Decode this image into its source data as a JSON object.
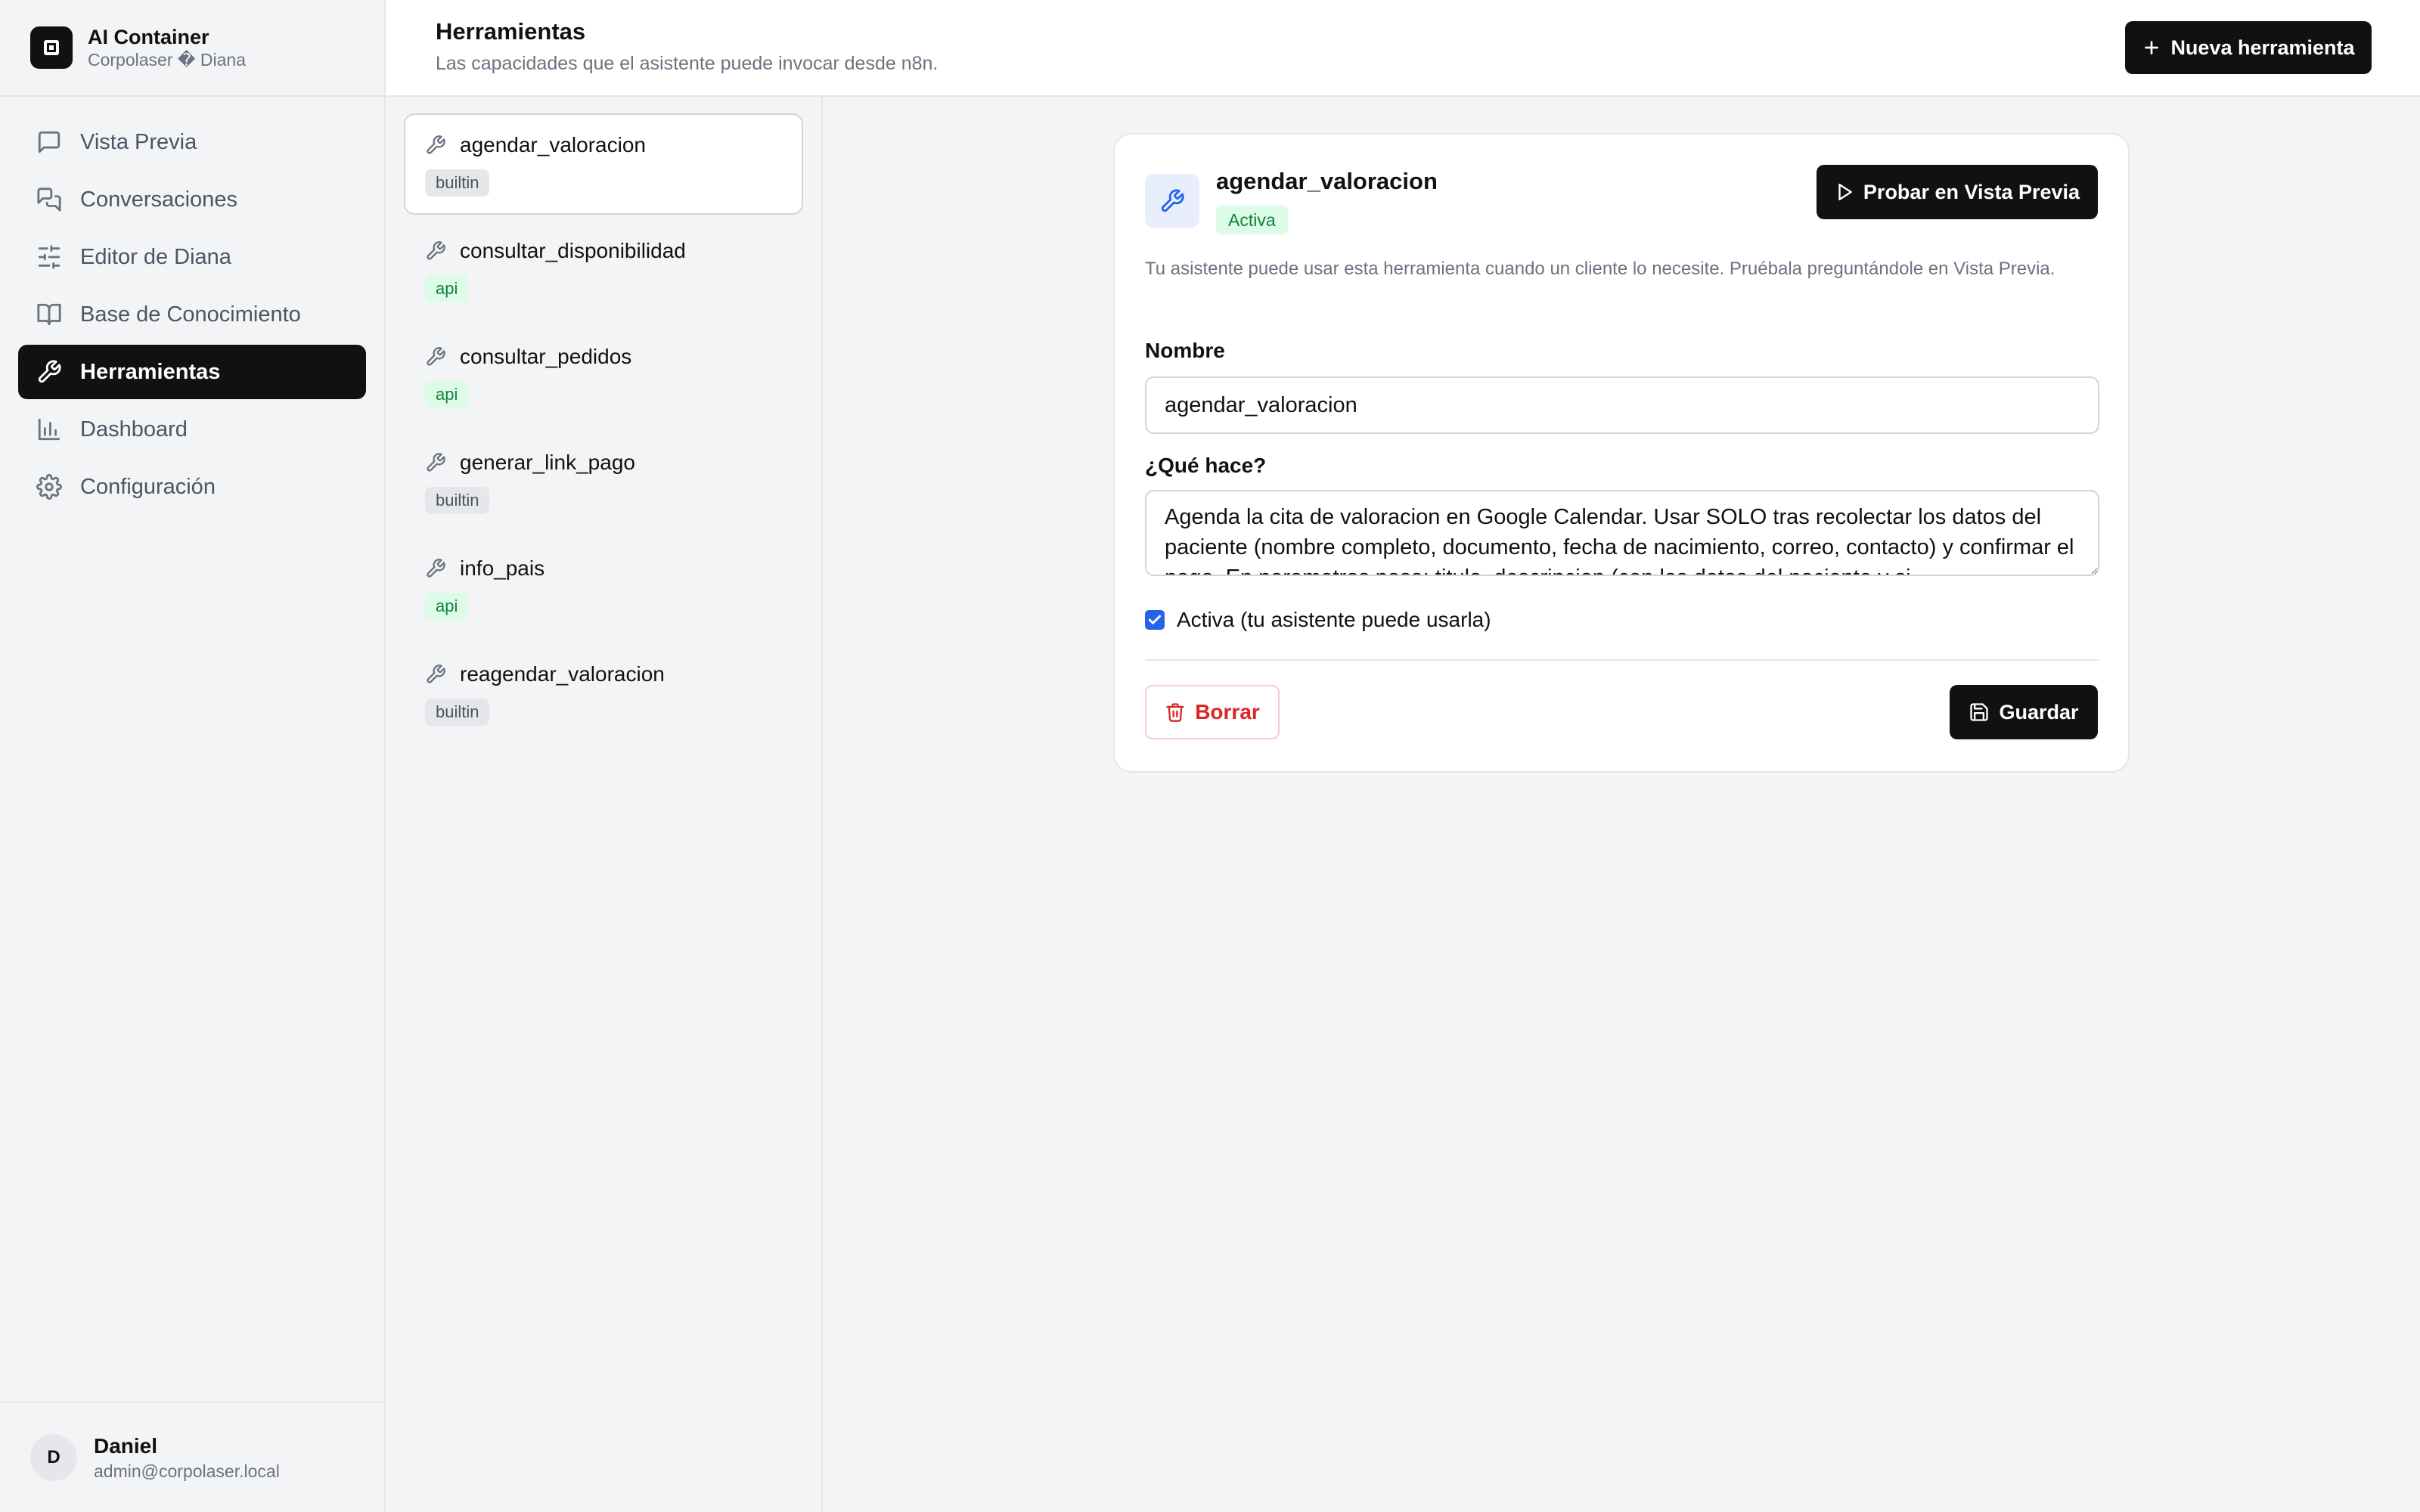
{
  "brand": {
    "title": "AI Container",
    "subtitle": "Corpolaser � Diana"
  },
  "nav": {
    "items": [
      {
        "label": "Vista Previa",
        "icon": "message-square-icon"
      },
      {
        "label": "Conversaciones",
        "icon": "messages-icon"
      },
      {
        "label": "Editor de Diana",
        "icon": "sliders-icon"
      },
      {
        "label": "Base de Conocimiento",
        "icon": "book-icon"
      },
      {
        "label": "Herramientas",
        "icon": "wrench-icon",
        "active": true
      },
      {
        "label": "Dashboard",
        "icon": "bar-chart-icon"
      },
      {
        "label": "Configuración",
        "icon": "gear-icon"
      }
    ]
  },
  "user": {
    "initial": "D",
    "name": "Daniel",
    "email": "admin@corpolaser.local"
  },
  "header": {
    "title": "Herramientas",
    "subtitle": "Las capacidades que el asistente puede invocar desde n8n.",
    "new_button": "Nueva herramienta"
  },
  "tools": [
    {
      "name": "agendar_valoracion",
      "type": "builtin",
      "selected": true
    },
    {
      "name": "consultar_disponibilidad",
      "type": "api"
    },
    {
      "name": "consultar_pedidos",
      "type": "api"
    },
    {
      "name": "generar_link_pago",
      "type": "builtin"
    },
    {
      "name": "info_pais",
      "type": "api"
    },
    {
      "name": "reagendar_valoracion",
      "type": "builtin"
    }
  ],
  "detail": {
    "title": "agendar_valoracion",
    "status": "Activa",
    "test_button": "Probar en Vista Previa",
    "description": "Tu asistente puede usar esta herramienta cuando un cliente lo necesite. Pruébala preguntándole en Vista Previa.",
    "name_label": "Nombre",
    "name_value": "agendar_valoracion",
    "what_label": "¿Qué hace?",
    "what_value": "Agenda la cita de valoracion en Google Calendar. Usar SOLO tras recolectar los datos del paciente (nombre completo, documento, fecha de nacimiento, correo, contacto) y confirmar el pago. En parametros pasa: titulo, descripcion (con los datos del paciente y si",
    "active_checked": true,
    "active_label": "Activa (tu asistente puede usarla)",
    "delete_button": "Borrar",
    "save_button": "Guardar"
  },
  "colors": {
    "primary": "#111111",
    "accent_blue": "#2563eb",
    "success_bg": "#dcfce7",
    "success_text": "#15803d",
    "danger": "#dc2626"
  }
}
